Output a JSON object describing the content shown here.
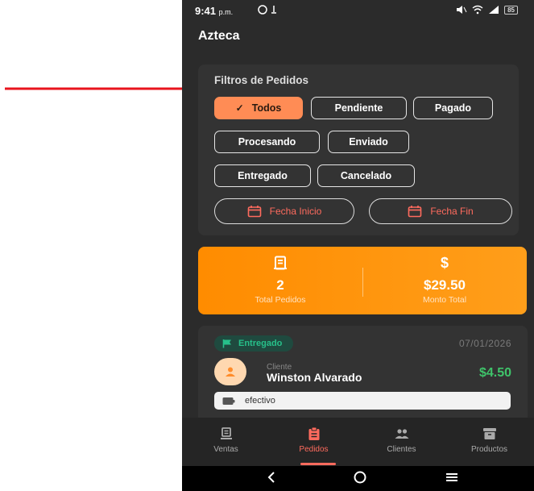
{
  "status": {
    "time": "9:41",
    "ampm": "p.m.",
    "battery": "85"
  },
  "app": {
    "title": "Azteca"
  },
  "filters": {
    "title": "Filtros de Pedidos",
    "chips": [
      "Todos",
      "Pendiente",
      "Pagado",
      "Procesando",
      "Enviado",
      "Entregado",
      "Cancelado"
    ],
    "selected": "Todos",
    "date_start": "Fecha Inicio",
    "date_end": "Fecha Fin"
  },
  "summary": {
    "total_orders": "2",
    "total_orders_label": "Total Pedidos",
    "total_amount": "$29.50",
    "total_amount_label": "Monto Total",
    "currency_symbol": "$"
  },
  "order": {
    "status": "Entregado",
    "date": "07/01/2026",
    "client_label": "Cliente",
    "client_name": "Winston Alvarado",
    "amount": "$4.50",
    "payment_method": "efectivo"
  },
  "nav": {
    "items": [
      "Ventas",
      "Pedidos",
      "Clientes",
      "Productos"
    ],
    "active": "Pedidos"
  },
  "colors": {
    "accent": "#ff8c55",
    "active": "#ff6b5e",
    "summary_gradient_start": "#ff8c00",
    "success": "#3fc36a",
    "badge_text": "#27c08a"
  }
}
